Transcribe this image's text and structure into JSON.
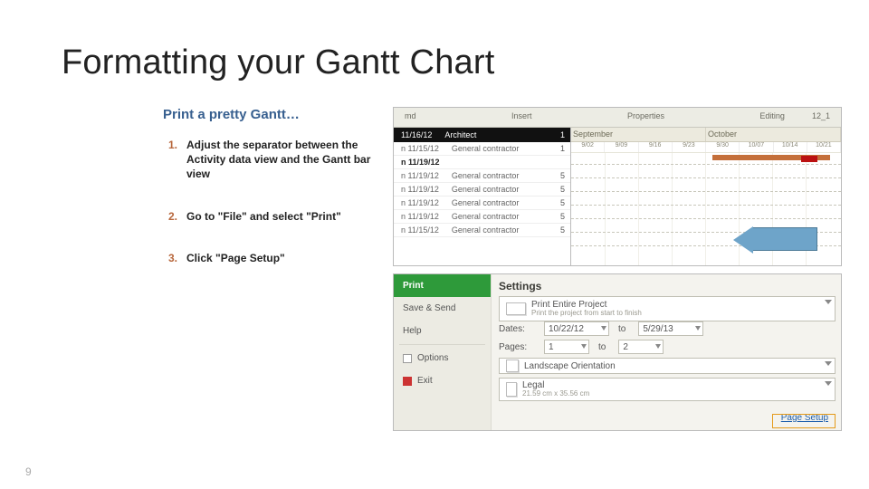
{
  "title": "Formatting your Gantt Chart",
  "subtitle": "Print a pretty Gantt…",
  "steps": [
    "Adjust the separator between the Activity data view and the Gantt bar view",
    "Go to \"File\" and select \"Print\"",
    "Click \"Page Setup\""
  ],
  "pageNumber": "9",
  "gantt": {
    "ribbon": {
      "a": "md",
      "b": "Insert",
      "c": "Properties",
      "d": "Editing",
      "e": "12_1"
    },
    "months": [
      "September",
      "October"
    ],
    "ticks": [
      "9/02",
      "9/09",
      "9/16",
      "9/23",
      "9/30",
      "10/07",
      "10/14",
      "10/21"
    ],
    "rowSel": {
      "date": "11/16/12",
      "role": "Architect"
    },
    "rows": [
      {
        "date": "n 11/15/12",
        "role": "General contractor"
      },
      {
        "date": "n 11/19/12",
        "role": ""
      },
      {
        "date": "n 11/19/12",
        "role": "General contractor"
      },
      {
        "date": "n 11/19/12",
        "role": "General contractor"
      },
      {
        "date": "n 11/19/12",
        "role": "General contractor"
      },
      {
        "date": "n 11/19/12",
        "role": "General contractor"
      },
      {
        "date": "n 11/15/12",
        "role": "General contractor"
      }
    ],
    "qtys": [
      "1",
      "1",
      "",
      "5",
      "5",
      "5",
      "5",
      "5"
    ]
  },
  "fileMenu": {
    "print": "Print",
    "saveSend": "Save & Send",
    "help": "Help",
    "options": "Options",
    "exit": "Exit"
  },
  "settings": {
    "header": "Settings",
    "project": {
      "title": "Print Entire Project",
      "sub": "Print the project from start to finish"
    },
    "datesLabel": "Dates:",
    "dateFrom": "10/22/12",
    "dateToLabel": "to",
    "dateTo": "5/29/13",
    "pagesLabel": "Pages:",
    "pageFrom": "1",
    "pageToLabel": "to",
    "pageTo": "2",
    "orientation": "Landscape Orientation",
    "paper": {
      "name": "Legal",
      "dims": "21.59 cm x 35.56 cm"
    },
    "pageSetup": "Page Setup"
  }
}
